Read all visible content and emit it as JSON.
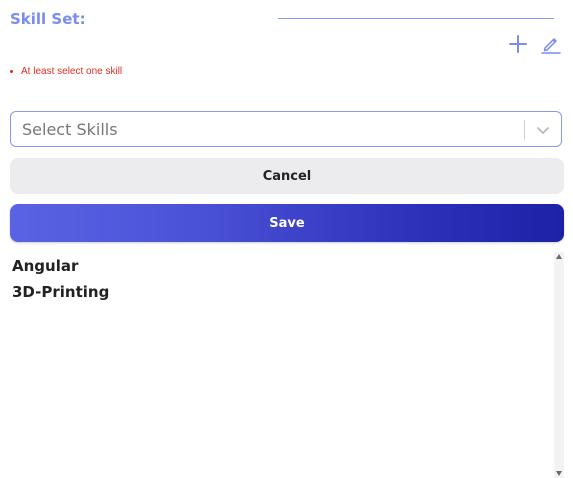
{
  "skill_set": {
    "label": "Skill Set:",
    "add_icon": "plus-icon",
    "edit_icon": "pencil-icon",
    "accent_color": "#7b8cf0"
  },
  "validation": {
    "message": "At least select one skill",
    "color": "#d93025"
  },
  "select": {
    "placeholder": "Select Skills",
    "chevron_icon": "chevron-down-icon"
  },
  "buttons": {
    "cancel_label": "Cancel",
    "save_label": "Save"
  },
  "skills_list": {
    "items": [
      "Angular",
      "3D-Printing"
    ]
  }
}
